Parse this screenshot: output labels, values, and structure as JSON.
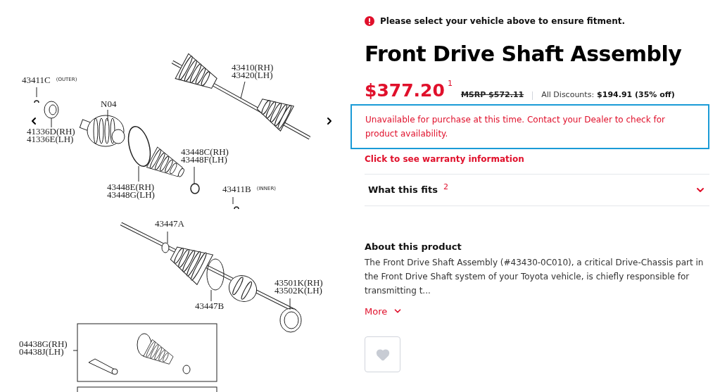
{
  "diagram": {
    "labels": [
      {
        "lines": [
          "43411C"
        ],
        "note": "(OUTER)"
      },
      {
        "lines": [
          "41336D(RH)",
          "41336E(LH)"
        ]
      },
      {
        "lines": [
          "N04"
        ]
      },
      {
        "lines": [
          "43410(RH)",
          "43420(LH)"
        ]
      },
      {
        "lines": [
          "43448C(RH)",
          "43448F(LH)"
        ]
      },
      {
        "lines": [
          "43448E(RH)",
          "43448G(LH)"
        ]
      },
      {
        "lines": [
          "43411B"
        ],
        "note": "(INNER)"
      },
      {
        "lines": [
          "43447A"
        ]
      },
      {
        "lines": [
          "43501K(RH)",
          "43502K(LH)"
        ]
      },
      {
        "lines": [
          "43447B"
        ]
      },
      {
        "lines": [
          "04438G(RH)",
          "04438J(LH)"
        ]
      }
    ]
  },
  "alert": {
    "text": "Please select your vehicle above to ensure fitment."
  },
  "title": "Front Drive Shaft Assembly",
  "price": {
    "current": "$377.20",
    "note": "1",
    "msrp": "MSRP $572.11",
    "discounts_label": "All Discounts:",
    "discounts_value": "$194.91 (35% off)"
  },
  "availability": {
    "message": "Unavailable for purchase at this time. Contact your Dealer to check for product availability.",
    "focused": true
  },
  "warranty_link": "Click to see warranty information",
  "accordion": {
    "label": "What this fits",
    "note": "2",
    "expanded": false
  },
  "about": {
    "heading": "About this product",
    "text": "The Front Drive Shaft Assembly (#43430-0C010), a critical Drive-Chassis part in the Front Drive Shaft system of your Toyota vehicle, is chiefly responsible for transmitting t...",
    "more": "More"
  },
  "favorite": {
    "on": false
  }
}
